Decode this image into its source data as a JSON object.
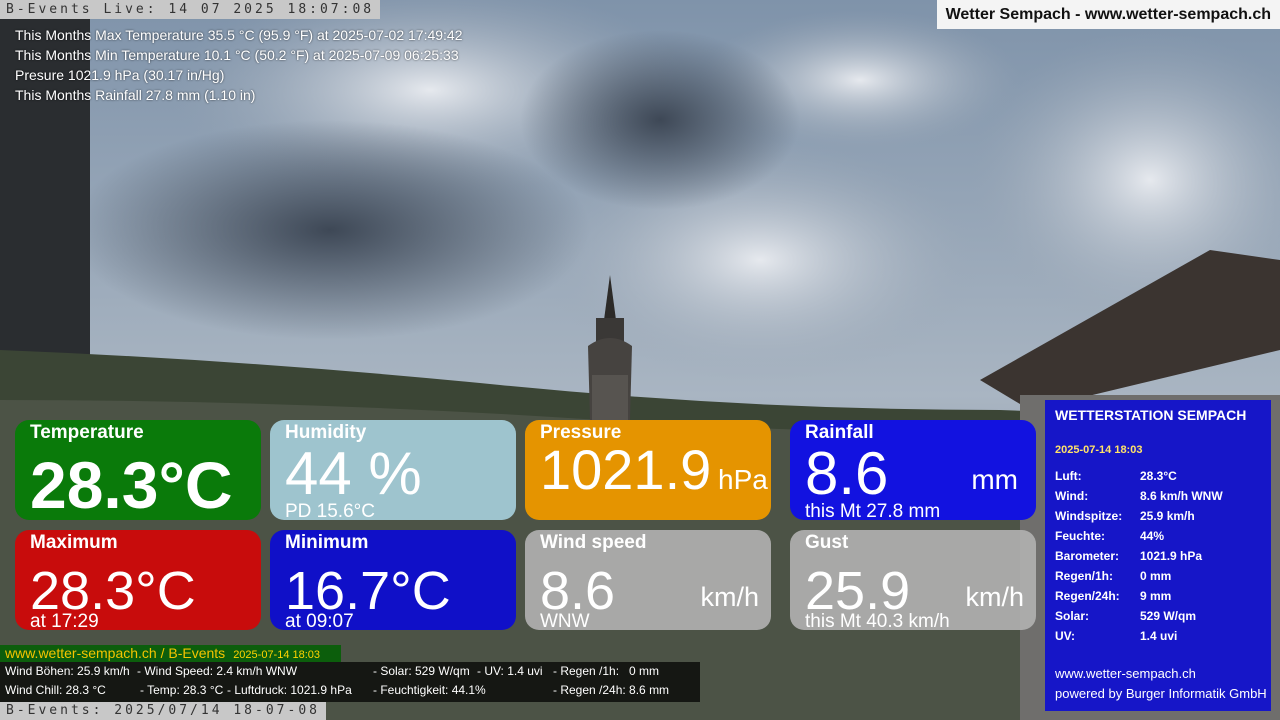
{
  "overlay": {
    "cam_top": "B-Events Live: 14 07 2025 18:07:08",
    "cam_bottom": "B-Events: 2025/07/14 18-07-08",
    "site_title": "Wetter Sempach - www.wetter-sempach.ch"
  },
  "info_lines": [
    "This Months Max Temperature 35.5 °C (95.9 °F) at 2025-07-02 17:49:42",
    "This Months Min Temperature 10.1 °C (50.2 °F) at 2025-07-09 06:25:33",
    "Presure 1021.9 hPa (30.17 in/Hg)",
    "This Months Rainfall 27.8 mm (1.10 in)"
  ],
  "cards": {
    "temperature": {
      "title": "Temperature",
      "value": "28.3°C",
      "unit": "",
      "sub": "",
      "color": "#0a7a0a"
    },
    "humidity": {
      "title": "Humidity",
      "value": "44 %",
      "unit": "",
      "sub": "PD 15.6°C",
      "color": "#add8e6"
    },
    "pressure": {
      "title": "Pressure",
      "value": "1021.9",
      "unit": "hPa",
      "sub": "",
      "color": "#e59400"
    },
    "rainfall": {
      "title": "Rainfall",
      "value": "8.6",
      "unit": "mm",
      "sub": "this Mt 27.8 mm",
      "color": "#1212e0"
    },
    "maximum": {
      "title": "Maximum",
      "value": "28.3°C",
      "unit": "",
      "sub": "at 17:29",
      "color": "#c80c0c"
    },
    "minimum": {
      "title": "Minimum",
      "value": "16.7°C",
      "unit": "",
      "sub": "at 09:07",
      "color": "#1010c8"
    },
    "wind": {
      "title": "Wind speed",
      "value": "8.6",
      "unit": "km/h",
      "sub": "WNW",
      "color": "#b0b0b0"
    },
    "gust": {
      "title": "Gust",
      "value": "25.9",
      "unit": "km/h",
      "sub": "this Mt 40.3 km/h",
      "color": "#b0b0b0"
    }
  },
  "station": {
    "title": "WETTERSTATION SEMPACH",
    "date": "2025-07-14 18:03",
    "rows": [
      {
        "k": "Luft:",
        "v": "28.3°C"
      },
      {
        "k": "Wind:",
        "v": "8.6 km/h  WNW"
      },
      {
        "k": "Windspitze:",
        "v": "25.9 km/h"
      },
      {
        "k": "Feuchte:",
        "v": "44%"
      },
      {
        "k": "Barometer:",
        "v": "1021.9 hPa"
      },
      {
        "k": "Regen/1h:",
        "v": "0 mm"
      },
      {
        "k": "Regen/24h:",
        "v": "9 mm"
      },
      {
        "k": "Solar:",
        "v": "529 W/qm"
      },
      {
        "k": "UV:",
        "v": "1.4 uvi"
      }
    ],
    "site": "www.wetter-sempach.ch",
    "powered": "powered by Burger Informatik GmbH"
  },
  "footer": {
    "link": "www.wetter-sempach.ch / B-Events",
    "date": "2025-07-14 18:03",
    "ticker": {
      "wind_gusts": "Wind Böhen: 25.9 km/h",
      "wind_speed": "- Wind Speed: 2.4 km/h WNW",
      "solar": "- Solar: 529 W/qm",
      "uv": "- UV: 1.4 uvi",
      "rain_1h": "- Regen /1h:   0 mm",
      "wind_chill": "Wind Chill: 28.3 °C",
      "temp": "- Temp: 28.3 °C",
      "pressure": "- Luftdruck: 1021.9 hPa",
      "humidity": "- Feuchtigkeit: 44.1%",
      "rain_24h": "- Regen /24h: 8.6 mm"
    }
  }
}
